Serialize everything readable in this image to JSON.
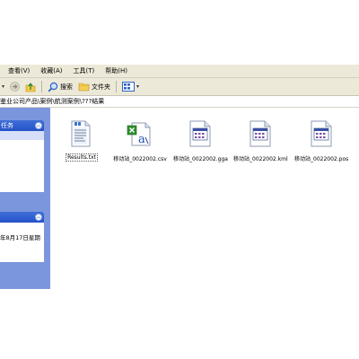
{
  "menu": {
    "items": [
      {
        "label": "查看(V)"
      },
      {
        "label": "收藏(A)"
      },
      {
        "label": "工具(T)"
      },
      {
        "label": "帮助(H)"
      }
    ]
  },
  "toolbar": {
    "search_label": "搜索",
    "folders_label": "文件夹"
  },
  "address": {
    "path": "鉴业公司产品\\案例\\航测案例\\???结果"
  },
  "sidebar": {
    "panel1_title": "任务",
    "panel2_detail": "年8月17日星期"
  },
  "files": [
    {
      "name": "Results.txt",
      "icon": "text-document-icon"
    },
    {
      "name": "移动站_0022002.csv",
      "icon": "csv-spreadsheet-icon"
    },
    {
      "name": "移动站_0022002.gga",
      "icon": "data-file-icon"
    },
    {
      "name": "移动站_0022002.kml",
      "icon": "data-file-icon"
    },
    {
      "name": "移动站_0022002.pos",
      "icon": "data-file-icon"
    }
  ],
  "colors": {
    "toolbar_bg": "#ece9d8",
    "sidepane_bg": "#7c96dd",
    "task_header": "#2453c7"
  }
}
